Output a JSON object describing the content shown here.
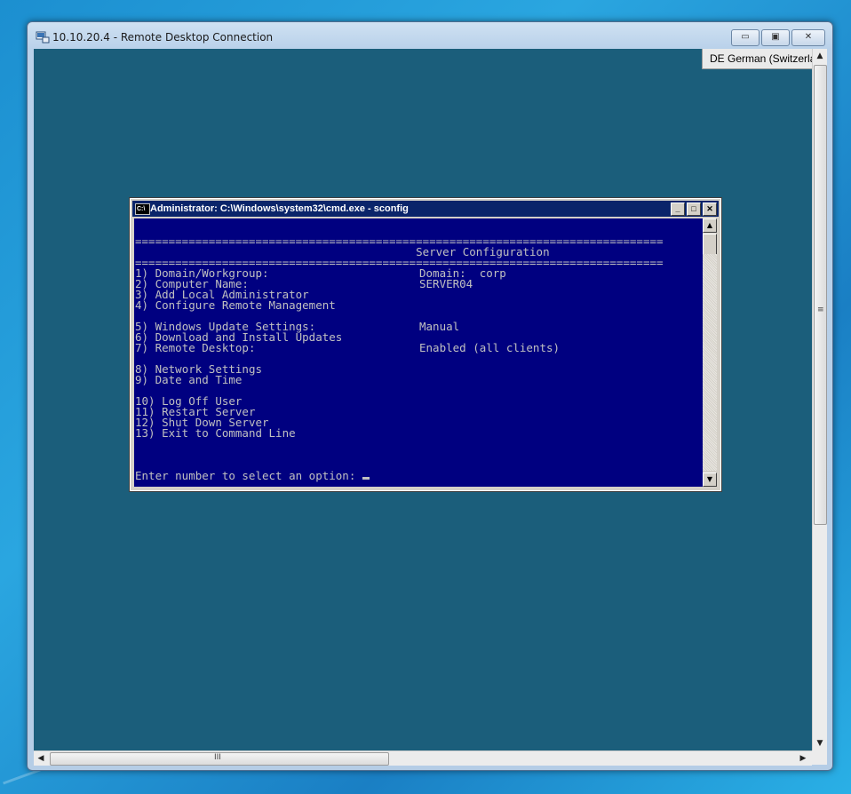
{
  "rdp": {
    "title": "10.10.20.4 - Remote Desktop Connection",
    "buttons": {
      "minimize": "▭",
      "maximize": "▣",
      "close": "✕"
    },
    "language_indicator": "DE German (Switzerland)",
    "hscroll_grip": "III",
    "vscroll_grip": "≡"
  },
  "cmd": {
    "title": "Administrator: C:\\Windows\\system32\\cmd.exe - sconfig",
    "icon_text": "C:\\",
    "buttons": {
      "minimize": "_",
      "maximize": "□",
      "close": "✕"
    },
    "separator": "===============================================================================",
    "heading": "                                          Server Configuration",
    "menu": [
      {
        "key": "1)",
        "label": "Domain/Workgroup:",
        "value": "Domain:  corp"
      },
      {
        "key": "2)",
        "label": "Computer Name:",
        "value": "SERVER04"
      },
      {
        "key": "3)",
        "label": "Add Local Administrator",
        "value": ""
      },
      {
        "key": "4)",
        "label": "Configure Remote Management",
        "value": ""
      },
      {
        "key": "5)",
        "label": "Windows Update Settings:",
        "value": "Manual"
      },
      {
        "key": "6)",
        "label": "Download and Install Updates",
        "value": ""
      },
      {
        "key": "7)",
        "label": "Remote Desktop:",
        "value": "Enabled (all clients)"
      },
      {
        "key": "8)",
        "label": "Network Settings",
        "value": ""
      },
      {
        "key": "9)",
        "label": "Date and Time",
        "value": ""
      },
      {
        "key": "10)",
        "label": "Log Off User",
        "value": ""
      },
      {
        "key": "11)",
        "label": "Restart Server",
        "value": ""
      },
      {
        "key": "12)",
        "label": "Shut Down Server",
        "value": ""
      },
      {
        "key": "13)",
        "label": "Exit to Command Line",
        "value": ""
      }
    ],
    "prompt": "Enter number to select an option: "
  },
  "colors": {
    "console_bg": "#000080",
    "console_fg": "#c0c0c0",
    "remote_desktop_bg": "#1b5e7b",
    "title_bar": "#0a246a"
  }
}
